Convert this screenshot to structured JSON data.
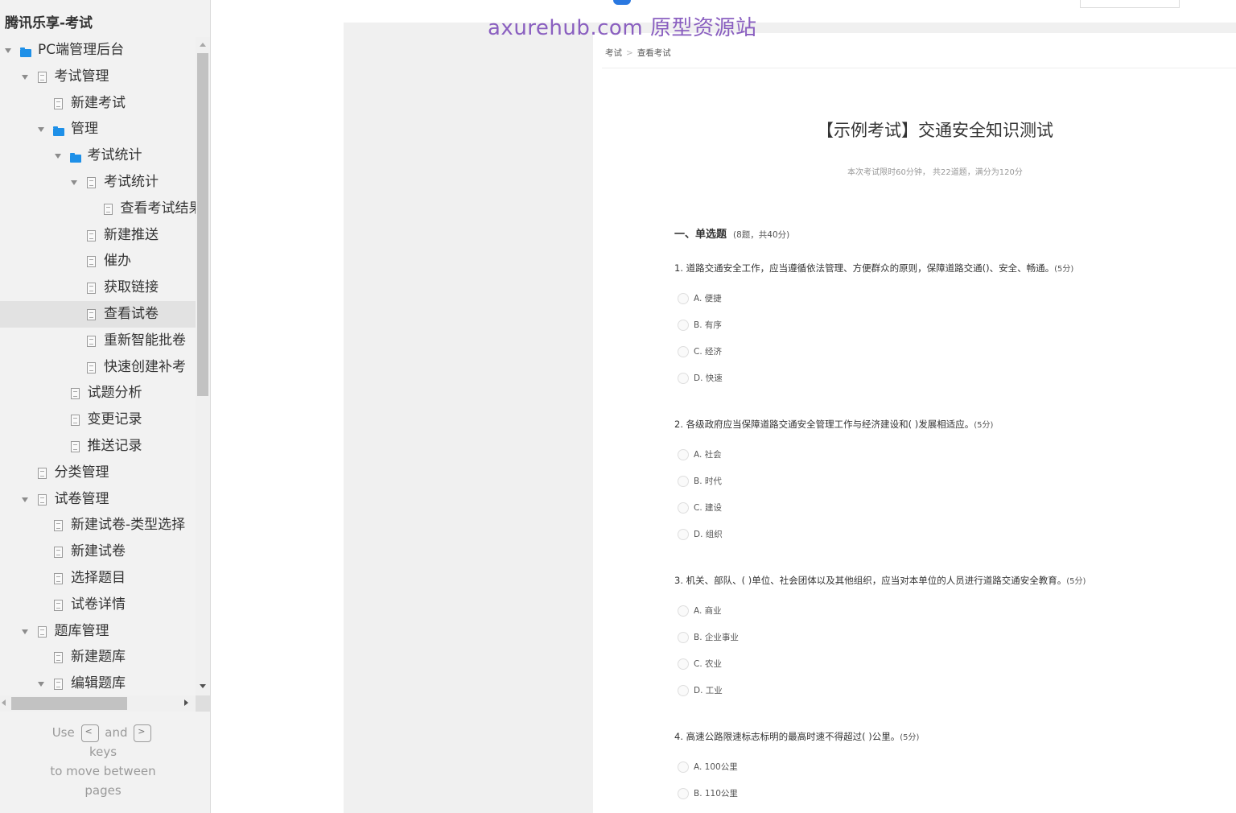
{
  "sidebar": {
    "project_title": "腾讯乐享-考试",
    "tree": [
      {
        "label": "PC端管理后台",
        "level": 0,
        "icon": "folder-icon",
        "expanded": true
      },
      {
        "label": "考试管理",
        "level": 1,
        "icon": "page-icon",
        "expanded": true
      },
      {
        "label": "新建考试",
        "level": 2,
        "icon": "page-icon"
      },
      {
        "label": "管理",
        "level": 2,
        "icon": "folder-icon",
        "expanded": true
      },
      {
        "label": "考试统计",
        "level": 3,
        "icon": "folder-icon",
        "expanded": true
      },
      {
        "label": "考试统计",
        "level": 4,
        "icon": "page-icon",
        "expanded": true
      },
      {
        "label": "查看考试结果",
        "level": 5,
        "icon": "page-icon"
      },
      {
        "label": "新建推送",
        "level": 4,
        "icon": "page-icon"
      },
      {
        "label": "催办",
        "level": 4,
        "icon": "page-icon"
      },
      {
        "label": "获取链接",
        "level": 4,
        "icon": "page-icon"
      },
      {
        "label": "查看试卷",
        "level": 4,
        "icon": "page-icon",
        "selected": true
      },
      {
        "label": "重新智能批卷",
        "level": 4,
        "icon": "page-icon"
      },
      {
        "label": "快速创建补考",
        "level": 4,
        "icon": "page-icon"
      },
      {
        "label": "试题分析",
        "level": 3,
        "icon": "page-icon"
      },
      {
        "label": "变更记录",
        "level": 3,
        "icon": "page-icon"
      },
      {
        "label": "推送记录",
        "level": 3,
        "icon": "page-icon"
      },
      {
        "label": "分类管理",
        "level": 1,
        "icon": "page-icon"
      },
      {
        "label": "试卷管理",
        "level": 1,
        "icon": "page-icon",
        "expanded": true
      },
      {
        "label": "新建试卷-类型选择",
        "level": 2,
        "icon": "page-icon"
      },
      {
        "label": "新建试卷",
        "level": 2,
        "icon": "page-icon"
      },
      {
        "label": "选择题目",
        "level": 2,
        "icon": "page-icon"
      },
      {
        "label": "试卷详情",
        "level": 2,
        "icon": "page-icon"
      },
      {
        "label": "题库管理",
        "level": 1,
        "icon": "page-icon",
        "expanded": true
      },
      {
        "label": "新建题库",
        "level": 2,
        "icon": "page-icon"
      },
      {
        "label": "编辑题库",
        "level": 2,
        "icon": "page-icon",
        "expanded": true
      }
    ],
    "key_hint": {
      "use": "Use",
      "prev_key": "<",
      "and": "and",
      "next_key": ">",
      "keys": "keys",
      "line2": "to move between",
      "line3": "pages"
    }
  },
  "watermark": {
    "host": "axurehub.com",
    "text": "原型资源站"
  },
  "breadcrumb": [
    "考试",
    "查看考试"
  ],
  "exam": {
    "title": "【示例考试】交通安全知识测试",
    "subtitle": "本次考试限时60分钟，  共22道题，满分为120分",
    "section": {
      "title": "一、单选题",
      "meta": "(8题，共40分)"
    },
    "questions": [
      {
        "text": "1. 道路交通安全工作，应当遵循依法管理、方便群众的原则，保障道路交通()、安全、畅通。",
        "score": "(5分)",
        "options": [
          "A. 便捷",
          "B. 有序",
          "C. 经济",
          "D. 快速"
        ]
      },
      {
        "text": "2. 各级政府应当保障道路交通安全管理工作与经济建设和( )发展相适应。",
        "score": "(5分)",
        "options": [
          "A. 社会",
          "B. 时代",
          "C. 建设",
          "D. 组织"
        ]
      },
      {
        "text": "3. 机关、部队、( )单位、社会团体以及其他组织，应当对本单位的人员进行道路交通安全教育。",
        "score": "(5分)",
        "options": [
          "A. 商业",
          "B. 企业事业",
          "C. 农业",
          "D. 工业"
        ]
      },
      {
        "text": "4. 高速公路限速标志标明的最高时速不得超过(    )公里。",
        "score": "(5分)",
        "options": [
          "A. 100公里",
          "B. 110公里"
        ]
      }
    ]
  },
  "colors": {
    "sidebar_bg": "#f2f2f2",
    "folder_blue": "#1e90e8",
    "watermark_purple": "#8a5fc0",
    "selected_row": "#e2e2e2"
  }
}
